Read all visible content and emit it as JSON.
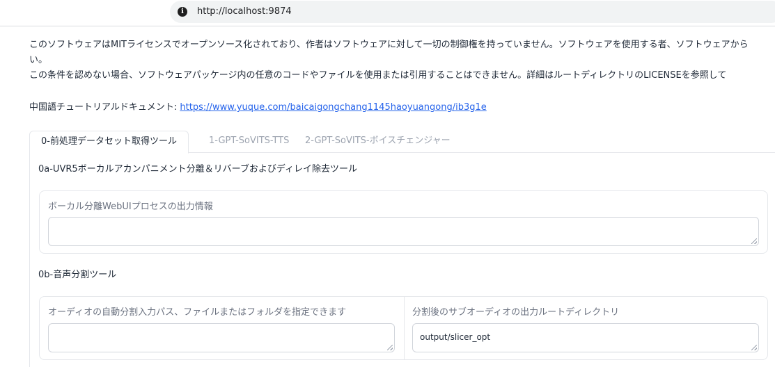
{
  "browser": {
    "url": "http://localhost:9874"
  },
  "notice": {
    "line1": "このソフトウェアはMITライセンスでオープンソース化されており、作者はソフトウェアに対して一切の制御権を持っていません。ソフトウェアを使用する者、ソフトウェアから",
    "line2": "い。",
    "line3": "この条件を認めない場合、ソフトウェアパッケージ内の任意のコードやファイルを使用または引用することはできません。詳細はルートディレクトリのLICENSEを参照して"
  },
  "tutorial": {
    "label": "中国語チュートリアルドキュメント:",
    "link": "https://www.yuque.com/baicaigongchang1145haoyuangong/ib3g1e"
  },
  "tabs": [
    {
      "label": "0-前処理データセット取得ツール",
      "active": true
    },
    {
      "label": "1-GPT-SoVITS-TTS",
      "active": false
    },
    {
      "label": "2-GPT-SoVITS-ボイスチェンジャー",
      "active": false
    }
  ],
  "section_0a": {
    "title": "0a-UVR5ボーカルアカンパニメント分離＆リバーブおよびディレイ除去ツール",
    "output_label": "ボーカル分離WebUIプロセスの出力情報",
    "output_value": ""
  },
  "section_0b": {
    "title": "0b-音声分割ツール",
    "input_label": "オーディオの自動分割入力パス、ファイルまたはフォルダを指定できます",
    "input_value": "",
    "output_root_label": "分割後のサブオーディオの出力ルートディレクトリ",
    "output_root_value": "output/slicer_opt"
  }
}
